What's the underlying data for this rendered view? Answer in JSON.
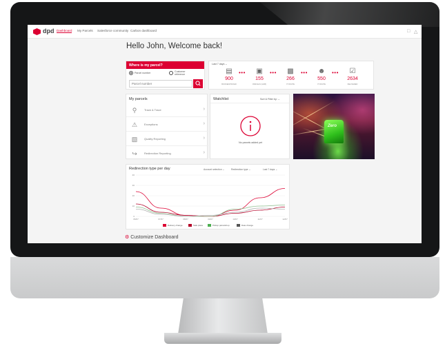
{
  "nav": {
    "brand": "dpd",
    "items": [
      "Dashboard",
      "My Parcels",
      "Salesforce community",
      "Carbon dashboard"
    ],
    "active_index": 0
  },
  "greeting": "Hello John, Welcome back!",
  "parcel_finder": {
    "title": "Where is my parcel?",
    "option_parcel": "Parcel number",
    "option_customer_line1": "Customer",
    "option_customer_line2": "reference",
    "placeholder": "Parcel number"
  },
  "stats": {
    "period": "Last 7 days",
    "items": [
      {
        "icon": "box-icon",
        "value": "900",
        "label": "BOOKED/PICKED"
      },
      {
        "icon": "parcel-icon",
        "value": "155",
        "label": "PARCELS (HUB)"
      },
      {
        "icon": "van-icon",
        "value": "266",
        "label": "IT ROUTE"
      },
      {
        "icon": "person-icon",
        "value": "550",
        "label": "IT ROUTE"
      },
      {
        "icon": "check-icon",
        "value": "2634",
        "label": "DELIVERED"
      }
    ]
  },
  "my_parcels": {
    "title": "My parcels",
    "items": [
      {
        "icon": "pin-icon",
        "label": "Track & Trace"
      },
      {
        "icon": "warning-icon",
        "label": "Exceptions"
      },
      {
        "icon": "bar-chart-icon",
        "label": "Quality Reporting"
      },
      {
        "icon": "redirect-icon",
        "label": "Redirection Reporting"
      }
    ]
  },
  "watchlist": {
    "title": "Watchlist",
    "sort_label": "Sort & Filter by:",
    "empty_text": "No parcels added yet"
  },
  "photo": {
    "badge": "Zero"
  },
  "chart": {
    "title": "Redirection type per day",
    "filters": [
      "Account selection",
      "Redirection type",
      "Last 7 days"
    ]
  },
  "chart_data": {
    "type": "line",
    "x": [
      "06/07",
      "07/07",
      "08/07",
      "09/07",
      "10/07",
      "11/07",
      "12/07"
    ],
    "ylim": [
      0,
      40
    ],
    "yticks": [
      0,
      10,
      20,
      30,
      40
    ],
    "series": [
      {
        "name": "Delivery change",
        "color": "#dc0032",
        "values": [
          24,
          8,
          1,
          0,
          6,
          18,
          27
        ]
      },
      {
        "name": "Safe place",
        "color": "#b30027",
        "values": [
          12,
          4,
          1,
          0,
          3,
          6,
          9
        ]
      },
      {
        "name": "Pickup parcelshop",
        "color": "#8fbf8f",
        "values": [
          9,
          3,
          0,
          0,
          7,
          10,
          11
        ]
      },
      {
        "name": "Date change",
        "color": "#b0b0b0",
        "values": [
          7,
          2,
          0,
          1,
          4,
          8,
          7
        ]
      }
    ]
  },
  "customize": "Customize Dashboard"
}
